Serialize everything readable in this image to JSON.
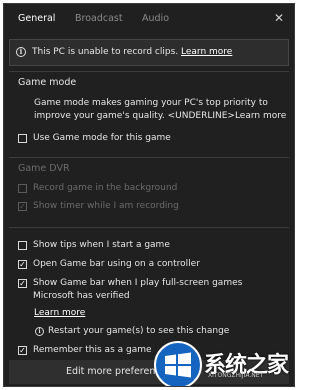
{
  "tabs": [
    "General",
    "Broadcast",
    "Audio"
  ],
  "close_glyph": "✕",
  "banner": {
    "icon": "info-icon",
    "text": "This PC is unable to record clips.",
    "link": "Learn more"
  },
  "game_mode": {
    "title": "Game mode",
    "description": "Game mode makes gaming your PC's top priority to improve your game's quality. <UNDERLINE>Learn more",
    "checkbox_label": "Use Game mode for this game",
    "checkbox_checked": false
  },
  "game_dvr": {
    "title": "Game DVR",
    "record_background_label": "Record game in the background",
    "record_background_checked": false,
    "show_timer_label": "Show timer while I am recording",
    "show_timer_checked": true
  },
  "options": {
    "show_tips_label": "Show tips when I start a game",
    "show_tips_checked": false,
    "open_game_bar_label": "Open Game bar using  on a controller",
    "open_game_bar_checked": true,
    "show_fullscreen_label": "Show Game bar when I play full-screen games Microsoft has verified",
    "show_fullscreen_checked": true,
    "learn_more": "Learn more",
    "restart_text": "Restart your game(s) to see this change",
    "remember_label": "Remember this as a game",
    "remember_checked": true
  },
  "footer": {
    "button_label": "Edit more preferences"
  },
  "watermark": {
    "text": "系统之家",
    "sub": "XITONGZHIJIA.NET"
  },
  "colors": {
    "background": "#202020",
    "banner": "#2d2d2d",
    "text": "#e6e6e6",
    "disabled_text": "#6b6b6b"
  }
}
